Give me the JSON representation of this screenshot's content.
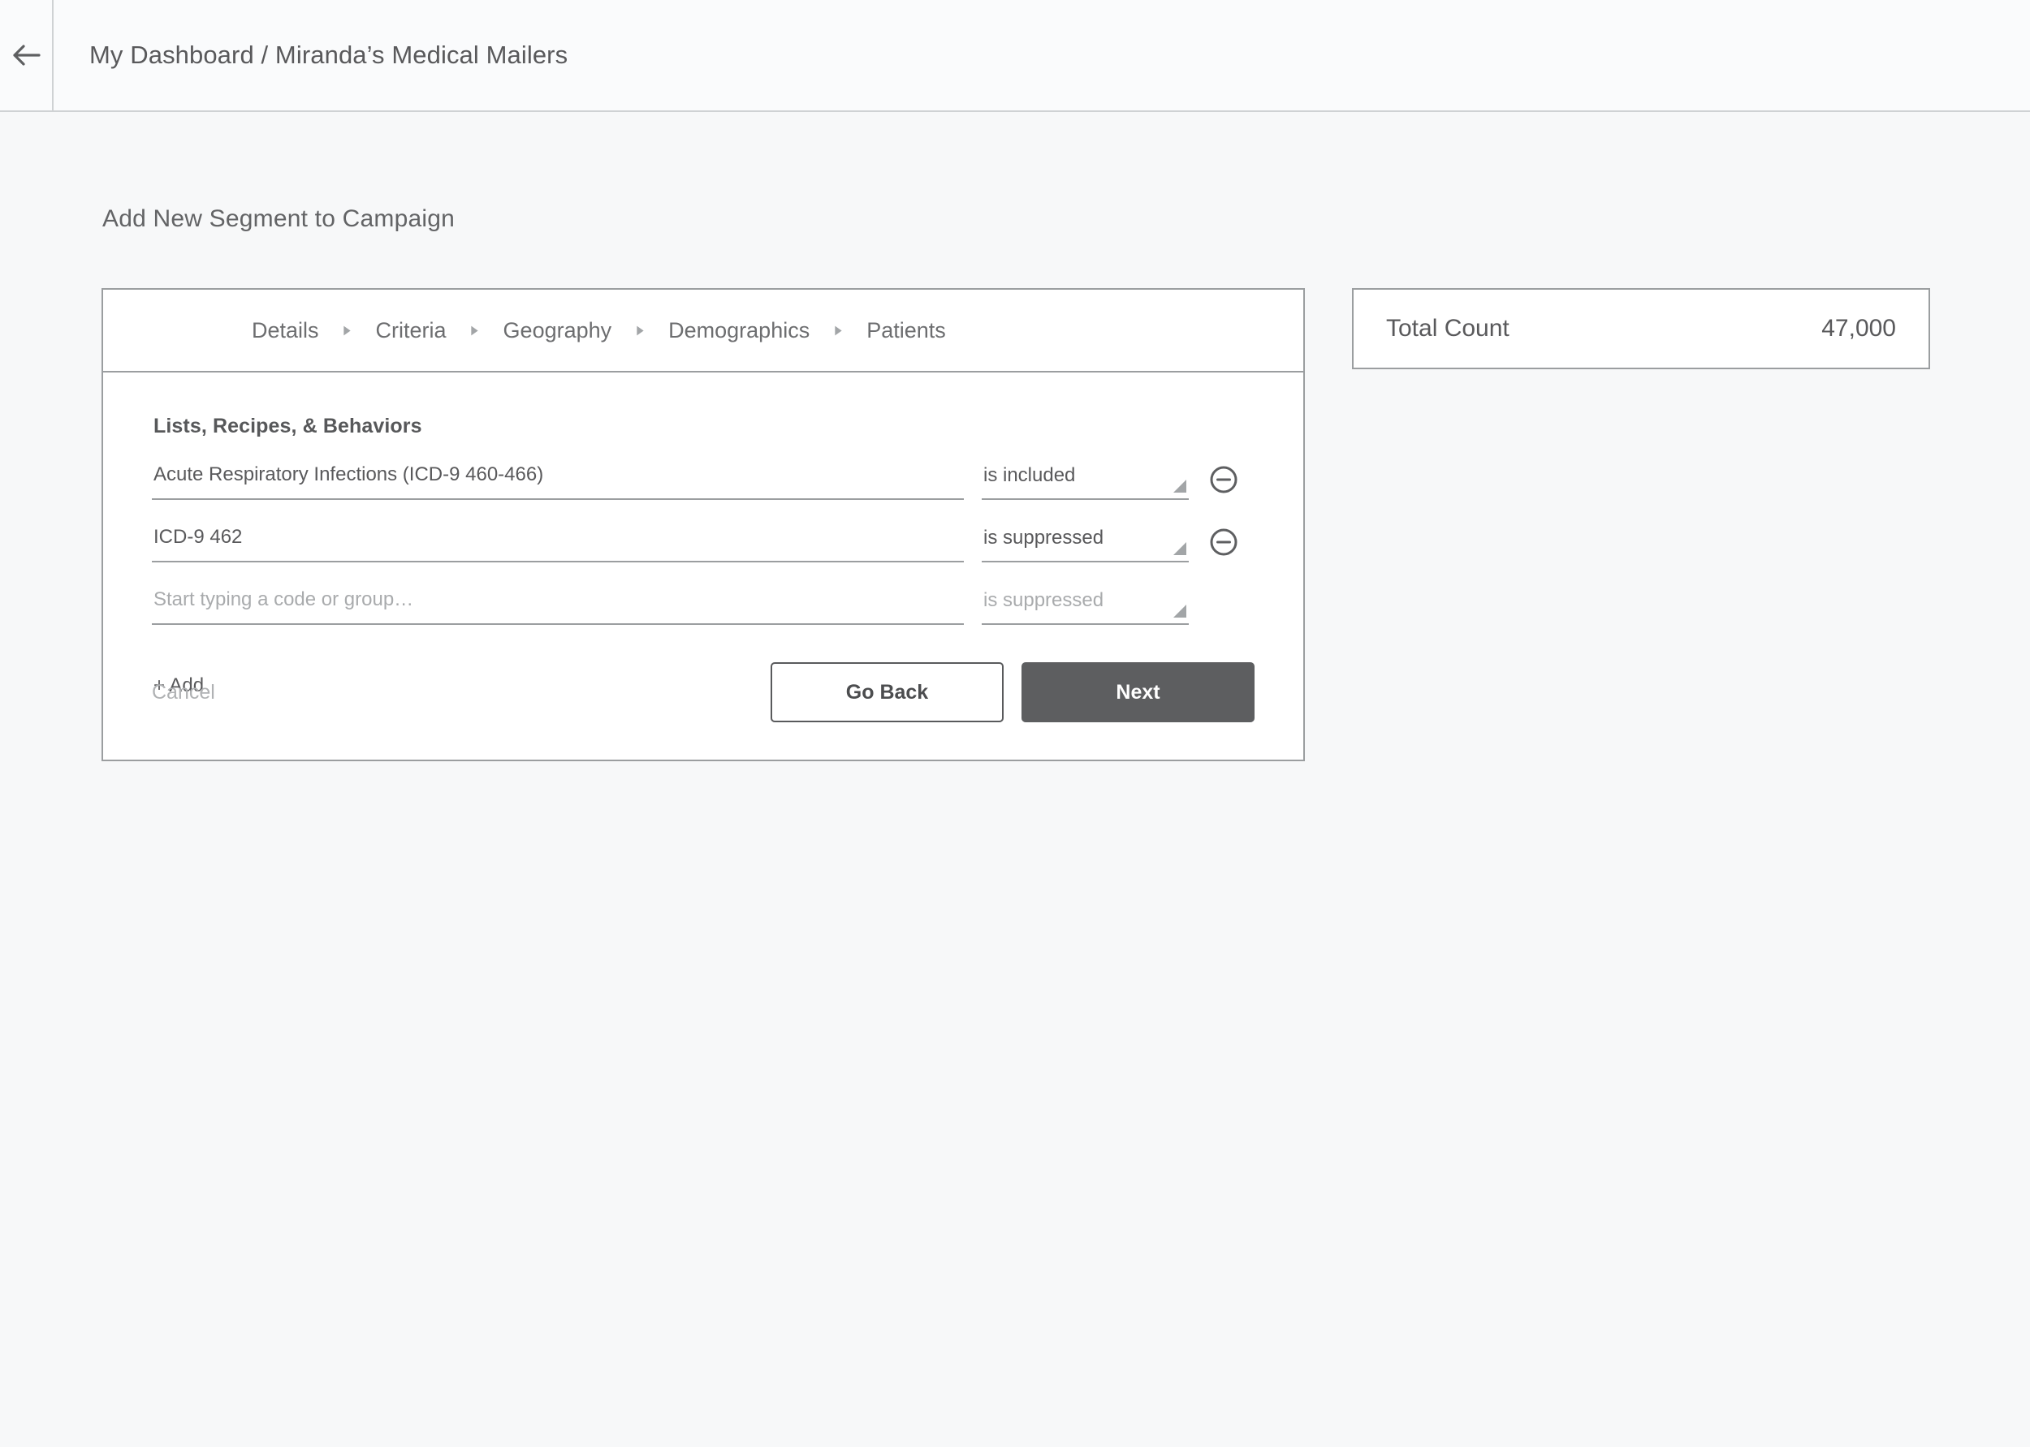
{
  "header": {
    "back_icon": "arrow-left-icon",
    "breadcrumb": "My Dashboard / Miranda’s Medical Mailers"
  },
  "page": {
    "title": "Add New Segment to Campaign"
  },
  "stepper": {
    "separator_icon": "caret-right-icon",
    "steps": [
      {
        "label": "Details"
      },
      {
        "label": "Criteria"
      },
      {
        "label": "Geography"
      },
      {
        "label": "Demographics"
      },
      {
        "label": "Patients"
      }
    ]
  },
  "form": {
    "section_title": "Lists, Recipes, & Behaviors",
    "rows": [
      {
        "value": "Acute Respiratory Infections (ICD-9 460-466)",
        "placeholder": "Start typing a code or group…",
        "condition": "is included",
        "remove_icon": "minus-circle-icon",
        "has_remove": true,
        "is_placeholder": false
      },
      {
        "value": "ICD-9 462",
        "placeholder": "Start typing a code or group…",
        "condition": "is suppressed",
        "remove_icon": "minus-circle-icon",
        "has_remove": true,
        "is_placeholder": false
      },
      {
        "value": "",
        "placeholder": "Start typing a code or group…",
        "condition": "is suppressed",
        "remove_icon": "",
        "has_remove": false,
        "is_placeholder": true
      }
    ],
    "add_label": "+ Add"
  },
  "actions": {
    "cancel_label": "Cancel",
    "go_back_label": "Go Back",
    "next_label": "Next"
  },
  "count_panel": {
    "label": "Total Count",
    "value": "47,000"
  },
  "colors": {
    "page_background": "#f7f8f9",
    "header_background": "#fafbfc",
    "card_background": "#ffffff",
    "border": "#9b9ea0",
    "text": "#59595b",
    "muted_text": "#a9abad",
    "primary_button": "#5d5e60"
  }
}
